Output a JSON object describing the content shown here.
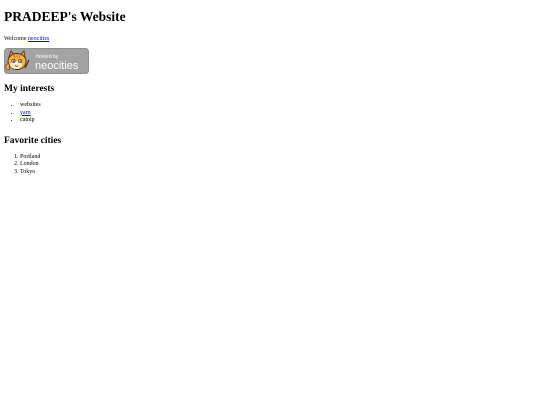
{
  "page": {
    "title": "PRADEEP's Website",
    "welcome_text": "Welcome ",
    "welcome_link": "neocities"
  },
  "badge": {
    "line1": "hosted by",
    "line2": "neocities",
    "background_color": "#a3a3a3"
  },
  "interests": {
    "heading": "My interests",
    "items": [
      {
        "label": "websites",
        "is_link": false
      },
      {
        "label": "yarn",
        "is_link": true
      },
      {
        "label": "catnip",
        "is_link": false
      }
    ]
  },
  "cities": {
    "heading": "Favorite cities",
    "items": [
      "Portland",
      "London",
      "Tokyo"
    ]
  },
  "colors": {
    "link": "#0000ee",
    "text": "#000000",
    "background": "#ffffff"
  }
}
